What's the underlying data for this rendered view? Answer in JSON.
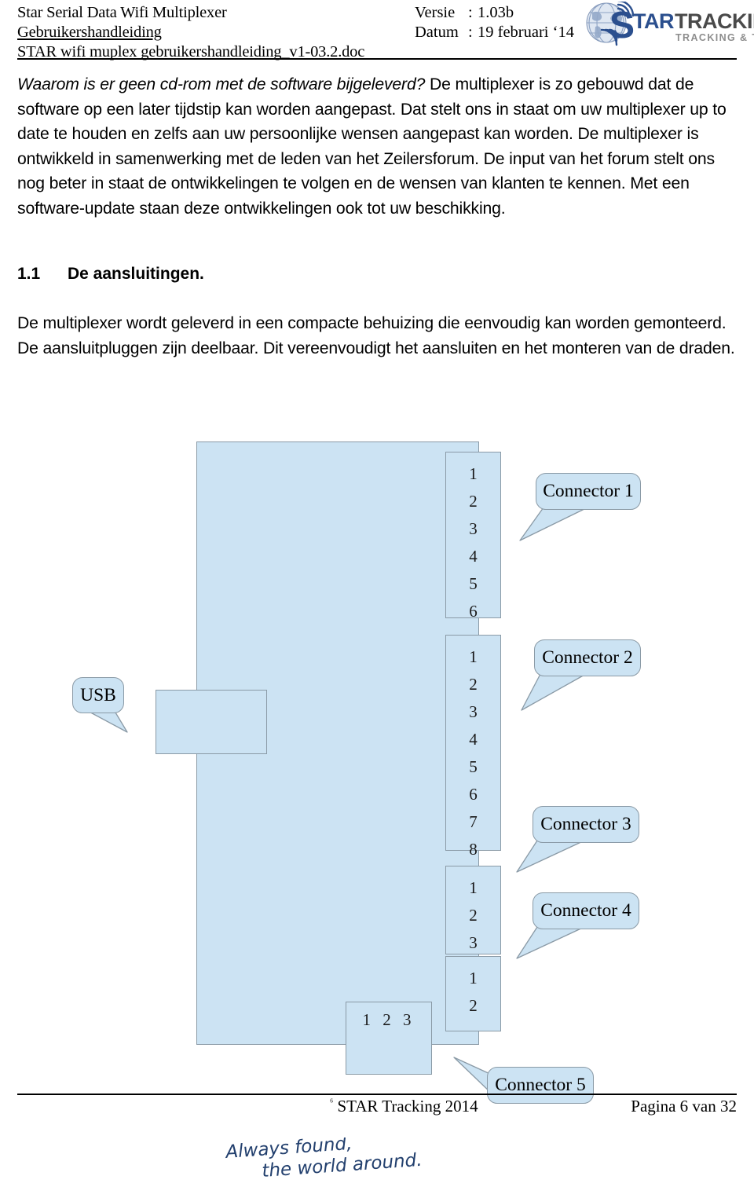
{
  "header": {
    "title_line1": "Star Serial Data Wifi Multiplexer",
    "title_line2": "Gebruikershandleiding",
    "filename": "STAR wifi muplex gebruikershandleiding_v1-03.2.doc",
    "version_key": "Versie",
    "version_sep": ":",
    "version_value": "1.03b",
    "date_key": "Datum",
    "date_sep": ":",
    "date_value": "19 februari ‘14",
    "logo": {
      "brand_s": "S",
      "brand_main": "TARTRACKING",
      "brand_sub": "TRACKING & TRACING",
      "brand_color": "#2b4f8e",
      "brand_accent": "#3c6bb5",
      "sub_color": "#8d8d8d"
    }
  },
  "body": {
    "paragraph1_lead": "Waarom is er geen cd-rom met de software bijgeleverd?",
    "paragraph1_rest": " De multiplexer is zo gebouwd dat de software op een later tijdstip kan worden aangepast. Dat stelt ons in staat om uw multiplexer up to date te houden en zelfs aan uw persoonlijke wensen aangepast kan worden. De multiplexer is ontwikkeld in samenwerking met de leden van het Zeilersforum. De input van het forum stelt ons nog beter in staat de ontwikkelingen te volgen en de wensen van klanten te kennen. Met een software-update staan deze ontwikkelingen ook tot uw beschikking.",
    "section_number": "1.1",
    "section_title": "De aansluitingen.",
    "paragraph2": "De multiplexer wordt geleverd in een compacte behuizing die eenvoudig kan worden gemonteerd. De aansluitpluggen zijn deelbaar. Dit vereenvoudigt het aansluiten en het monteren van de draden."
  },
  "diagram": {
    "fill_color": "#cce3f3",
    "stroke_color": "#8a9aa6",
    "usb_label": "USB",
    "connector1_label": "Connector 1",
    "connector2_label": "Connector 2",
    "connector3_label": "Connector 3",
    "connector4_label": "Connector 4",
    "connector5_label": "Connector 5",
    "connector1_pins": "1\n2\n3\n4\n5\n6",
    "connector2_pins": "1\n2\n3\n4\n5\n6\n7\n8",
    "connector3_pins": "1\n2\n3",
    "connector4_pins": "1\n2",
    "connector5_pins": "1 2 3"
  },
  "footer": {
    "copyright_mark": "⁶",
    "copyright_text": "STAR Tracking 2014",
    "page_text": "Pagina 6 van 32",
    "tagline_line1": "Always found,",
    "tagline_line2": "the world around.",
    "tagline_color": "#23406e"
  }
}
